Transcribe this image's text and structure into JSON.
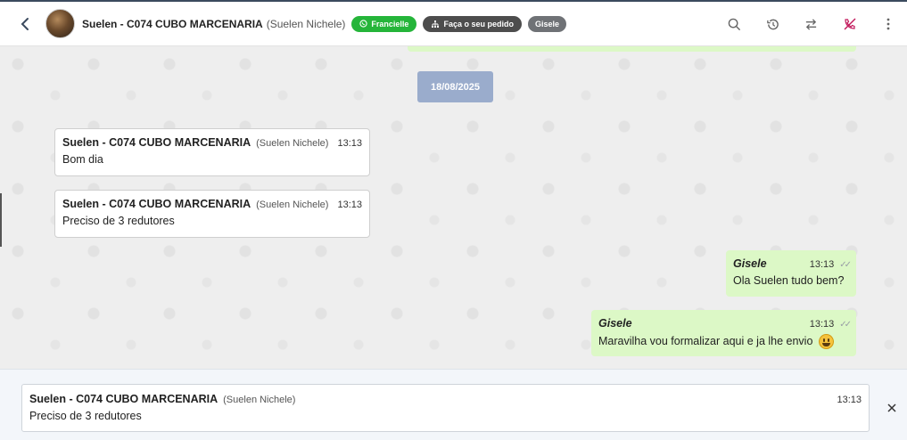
{
  "header": {
    "name": "Suelen - C074 CUBO MARCENARIA",
    "subname": "(Suelen Nichele)",
    "tags": [
      {
        "label": "Francielle",
        "icon": "whatsapp-icon"
      },
      {
        "label": "Faça o seu pedido",
        "icon": "org-icon"
      },
      {
        "label": "Gisele"
      }
    ],
    "icons": [
      "search-icon",
      "history-icon",
      "transfer-icon",
      "end-call-icon",
      "more-icon"
    ]
  },
  "chat": {
    "date": "18/08/2025",
    "incoming": [
      {
        "sender": "Suelen - C074 CUBO MARCENARIA",
        "subname": "(Suelen Nichele)",
        "time": "13:13",
        "text": "Bom dia"
      },
      {
        "sender": "Suelen - C074 CUBO MARCENARIA",
        "subname": "(Suelen Nichele)",
        "time": "13:13",
        "text": "Preciso de 3 redutores"
      }
    ],
    "outgoing": [
      {
        "sender": "Gisele",
        "time": "13:13",
        "text": "Ola Suelen tudo bem?"
      },
      {
        "sender": "Gisele",
        "time": "13:13",
        "text": "Maravilha vou formalizar aqui e ja lhe envio"
      }
    ]
  },
  "reply": {
    "sender": "Suelen - C074 CUBO MARCENARIA",
    "subname": "(Suelen Nichele)",
    "time": "13:13",
    "text": "Preciso de 3 redutores"
  },
  "colors": {
    "accent_green": "#25b53a",
    "bubble_out": "#dcf8c6",
    "date_pill": "#9aaccc",
    "end_call": "#c2185b"
  }
}
